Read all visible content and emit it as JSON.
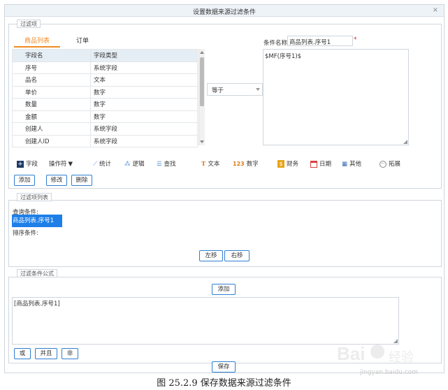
{
  "dialog": {
    "title": "设置数据来源过滤条件",
    "close_glyph": "×"
  },
  "filter": {
    "legend": "过滤项",
    "tabs": [
      "商品列表",
      "订单"
    ],
    "columns": [
      "字段名",
      "字段类型"
    ],
    "rows": [
      [
        "序号",
        "系统字段"
      ],
      [
        "品名",
        "文本"
      ],
      [
        "单价",
        "数字"
      ],
      [
        "数量",
        "数字"
      ],
      [
        "金额",
        "数字"
      ],
      [
        "创建人",
        "系统字段"
      ],
      [
        "创建人ID",
        "系统字段"
      ]
    ],
    "operator": "等于",
    "condition_label": "条件名称:",
    "condition_value": "商品列表.序号1",
    "required_mark": "*",
    "formula": "$MF(序号1)$"
  },
  "toolbar": {
    "field": "字段",
    "operator": "操作符",
    "stats": "统计",
    "logic": "逻辑",
    "lookup": "查找",
    "text": "文本",
    "number": "数字",
    "finance": "财务",
    "date": "日期",
    "other": "其他",
    "extend": "拓展"
  },
  "actions": {
    "add": "添加",
    "edit": "修改",
    "delete": "删除"
  },
  "list": {
    "legend": "过滤项列表",
    "query_label": "查询条件:",
    "selected_item": "商品列表.序号1",
    "sort_label": "排序条件:",
    "move_left": "左移",
    "move_right": "右移"
  },
  "formula_section": {
    "legend": "过滤条件公式",
    "add": "添加",
    "text": "[商品列表.序号1]",
    "or": "或",
    "and": "并且",
    "not": "非",
    "save": "保存"
  },
  "caption": "图 25.2.9  保存数据来源过滤条件",
  "watermark": {
    "brand": "Bai",
    "sub": "经验",
    "url": "jingyan.baidu.com"
  },
  "colors": {
    "accent": "#f08a24",
    "selection": "#1e7fe8",
    "button_border": "#2f7fd1",
    "required": "#e02020"
  }
}
